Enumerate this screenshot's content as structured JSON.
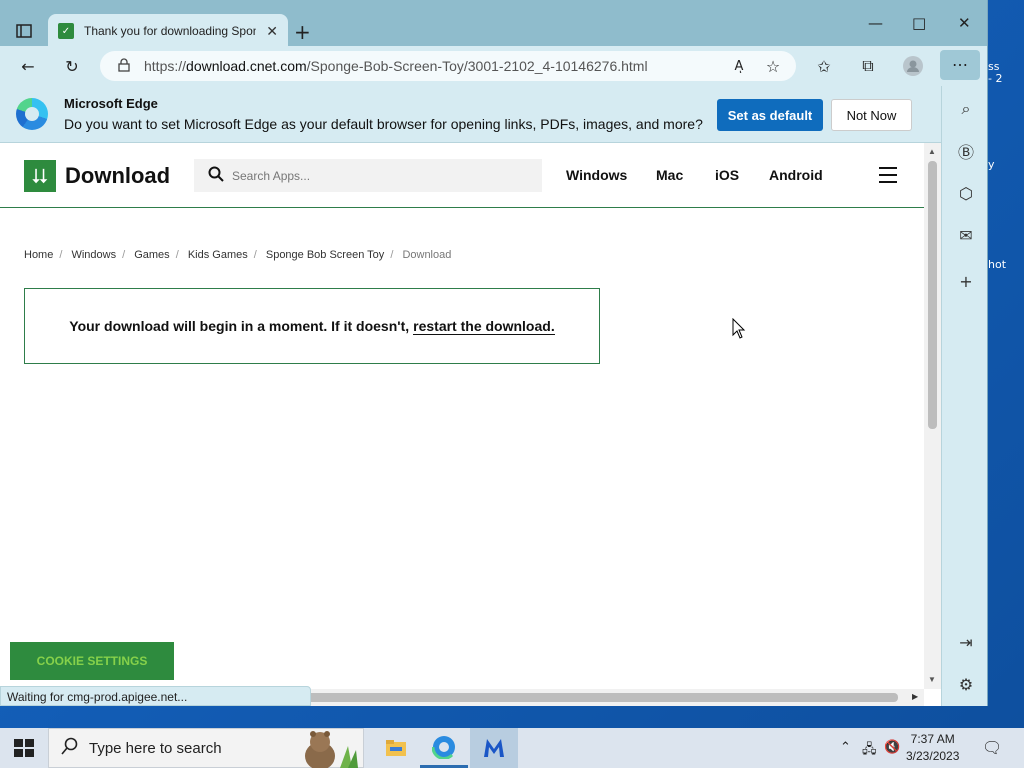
{
  "browser": {
    "tab_title": "Thank you for downloading Sponge Bob Screen Toy",
    "tab_favicon": "download-favicon",
    "url_prefix": "https://",
    "url_host": "download.cnet.com",
    "url_path": "/Sponge-Bob-Screen-Toy/3001-2102_4-10146276.html"
  },
  "infobar": {
    "title": "Microsoft Edge",
    "text": "Do you want to set Microsoft Edge as your default browser for opening links, PDFs, images, and more?",
    "set_default": "Set as default",
    "not_now": "Not Now"
  },
  "site": {
    "logo_text": "Download",
    "search_placeholder": "Search Apps...",
    "nav": [
      "Windows",
      "Mac",
      "iOS",
      "Android"
    ]
  },
  "breadcrumb": [
    "Home",
    "Windows",
    "Games",
    "Kids Games",
    "Sponge Bob Screen Toy",
    "Download"
  ],
  "download_box": {
    "message": "Your download will begin in a moment. If it doesn't,",
    "link": "restart the download."
  },
  "cookie_button": "COOKIE SETTINGS",
  "status_text": "Waiting for cmg-prod.apigee.net...",
  "desktop_fragments": [
    "ss",
    "- 2",
    "y",
    "hot"
  ],
  "taskbar": {
    "search_placeholder": "Type here to search",
    "time": "7:37 AM",
    "date": "3/23/2023"
  },
  "colors": {
    "brand_green": "#2e8b3e",
    "edge_blue": "#0f6cbd",
    "chrome_teal": "#8fbccc"
  }
}
